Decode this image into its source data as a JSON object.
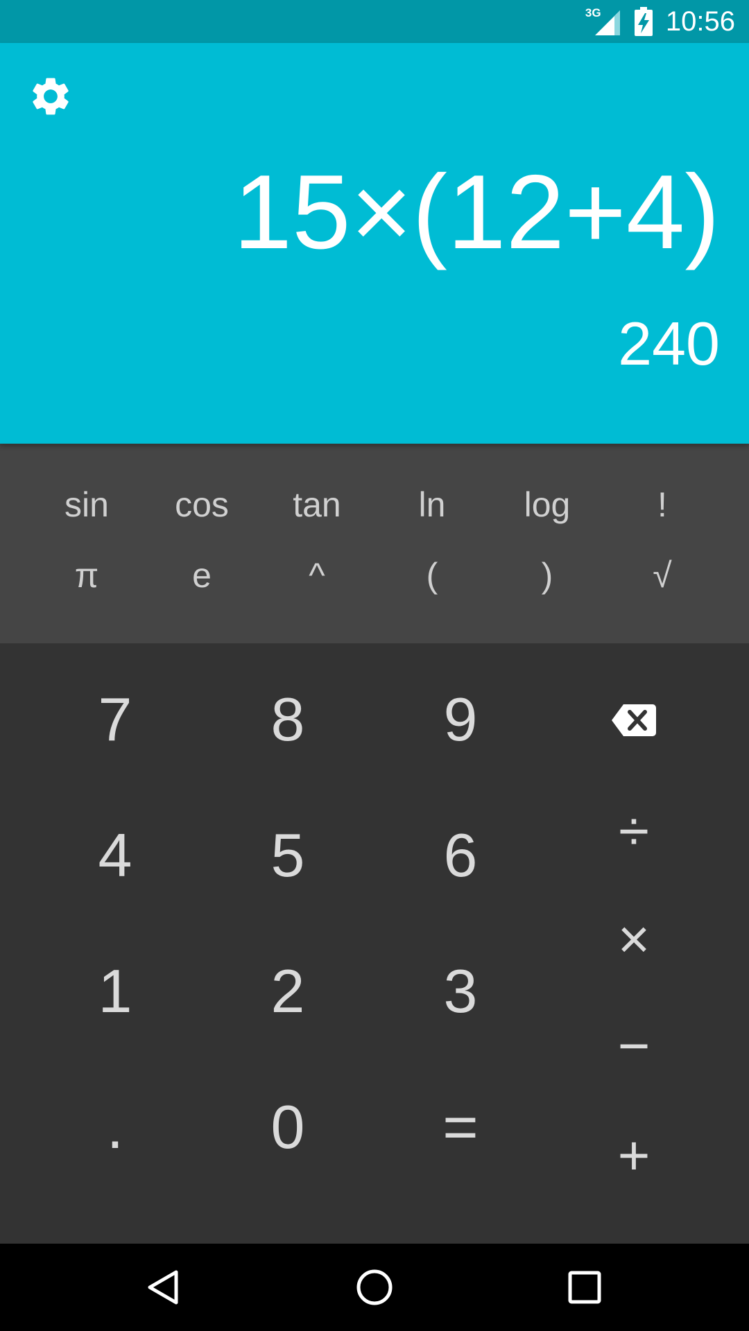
{
  "status_bar": {
    "network_label": "3G",
    "time": "10:56"
  },
  "display": {
    "expression": "15×(12+4)",
    "result": "240"
  },
  "advanced_pad": {
    "row1": [
      "sin",
      "cos",
      "tan",
      "ln",
      "log",
      "!"
    ],
    "row2": [
      "π",
      "e",
      "^",
      "(",
      ")",
      "√"
    ]
  },
  "digit_pad": {
    "rows": [
      [
        "7",
        "8",
        "9"
      ],
      [
        "4",
        "5",
        "6"
      ],
      [
        "1",
        "2",
        "3"
      ],
      [
        ".",
        "0",
        "="
      ]
    ]
  },
  "operators": {
    "divide": "÷",
    "multiply": "×",
    "subtract": "−",
    "add": "+"
  },
  "icons": {
    "settings": "gear-icon",
    "delete": "backspace-icon",
    "signal": "cell-signal-icon",
    "battery": "battery-charging-icon",
    "back": "back-triangle-icon",
    "home": "home-circle-icon",
    "recents": "recents-square-icon"
  },
  "colors": {
    "status_bar": "#0197A7",
    "display": "#00BCD4",
    "advanced_pad": "#454545",
    "main_pad": "#333333",
    "nav_bar": "#000000"
  }
}
